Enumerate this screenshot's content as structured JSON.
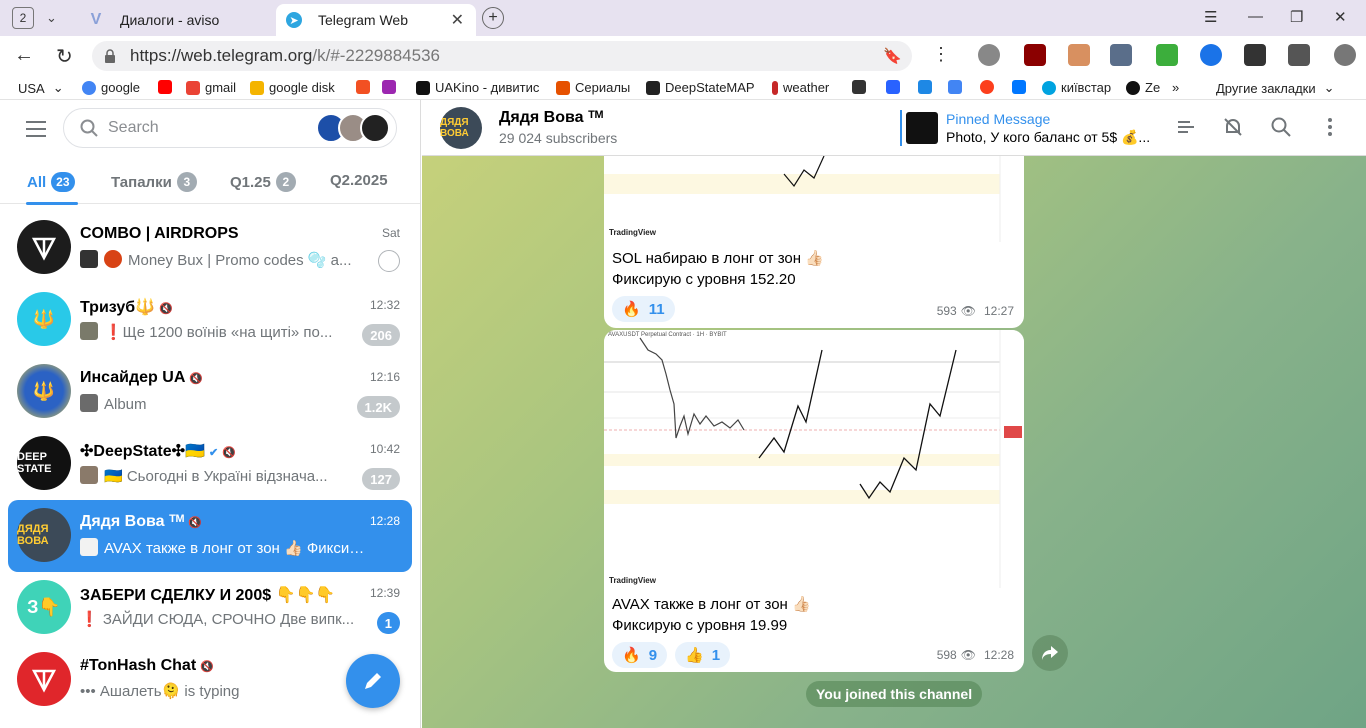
{
  "browser": {
    "tab_count": "2",
    "tabs": [
      {
        "title": "Диалоги - aviso",
        "icon": "aviso-icon"
      },
      {
        "title": "Telegram Web",
        "icon": "telegram-icon"
      }
    ],
    "url_host": "https://web.telegram.org",
    "url_path": "/k/#-2229884536",
    "bookmarks": [
      "USA",
      "google",
      "gmail",
      "google disk",
      "UAKino - дивитис",
      "Сериалы",
      "DeepStateMAP",
      "weather",
      "київстар",
      "Ze",
      "Другие закладки"
    ]
  },
  "sidebar": {
    "search_placeholder": "Search",
    "folders": [
      {
        "label": "All",
        "count": "23"
      },
      {
        "label": "Тапалки",
        "count": "3"
      },
      {
        "label": "Q1.25",
        "count": "2"
      },
      {
        "label": "Q2.2025",
        "count": ""
      }
    ],
    "chats": [
      {
        "name": "COMBO | AIRDROPS",
        "time": "Sat",
        "preview": "Money Bux | Promo codes 🫧 a...",
        "badge": "",
        "avatar_color": "#1c1c1c",
        "avatar_text": "▽"
      },
      {
        "name": "Тризуб🔱",
        "time": "12:32",
        "preview": "❗Ще 1200 воїнів «на щиті» по...",
        "badge": "206",
        "avatar_color": "#29c9e8",
        "avatar_text": "🔱"
      },
      {
        "name": "Инсайдер UA",
        "time": "12:16",
        "preview": "Album",
        "badge": "1.2K",
        "avatar_color": "#1f4fa0",
        "avatar_text": "🔱"
      },
      {
        "name": "✣DeepState✣🇺🇦",
        "time": "10:42",
        "preview": "🇺🇦 Сьогодні в Україні відзнача...",
        "badge": "127",
        "avatar_color": "#111111",
        "avatar_text": "DS"
      },
      {
        "name": "Дядя Вова ᵀᴹ",
        "time": "12:28",
        "preview": "AVAX также в лонг от зон 👍🏻 Фиксиру...",
        "badge": "",
        "avatar_color": "#3c4a58",
        "avatar_text": "ДЯДЯ"
      },
      {
        "name": "ЗАБЕРИ СДЕЛКУ И 200$ 👇👇👇",
        "time": "12:39",
        "preview": "❗ ЗАЙДИ СЮДА, СРОЧНО Две випк...",
        "badge": "1",
        "avatar_color": "#3fd3b8",
        "avatar_text": "З👇"
      },
      {
        "name": "#TonHash Chat",
        "time": "",
        "preview": "••• Ашалеть🫠 is typing",
        "badge": "",
        "avatar_color": "#e0262b",
        "avatar_text": "▽"
      }
    ]
  },
  "channel": {
    "title": "Дядя Вова ᵀᴹ",
    "subscribers": "29 024 subscribers",
    "pinned_label": "Pinned Message",
    "pinned_text": "Photo, У кого баланс от 5$ 💰...",
    "messages": [
      {
        "line1": "SOL набираю в лонг от зон 👍🏻",
        "line2": "Фиксирую с уровня 152.20",
        "reactions": [
          {
            "emoji": "🔥",
            "count": "11"
          }
        ],
        "views": "593",
        "time": "12:27"
      },
      {
        "line1": "AVAX также в лонг от зон 👍🏻",
        "line2": "Фиксирую с уровня 19.99",
        "reactions": [
          {
            "emoji": "🔥",
            "count": "9"
          },
          {
            "emoji": "👍",
            "count": "1"
          }
        ],
        "views": "598",
        "time": "12:28"
      }
    ],
    "chart_brand": "TradingView",
    "chart_caption": "AVAXUSDT Perpetual Contract · 1H · BYBIT",
    "service_message": "You joined this channel"
  },
  "colors": {
    "accent": "#3390ec",
    "selected_bg": "#3390ec"
  }
}
